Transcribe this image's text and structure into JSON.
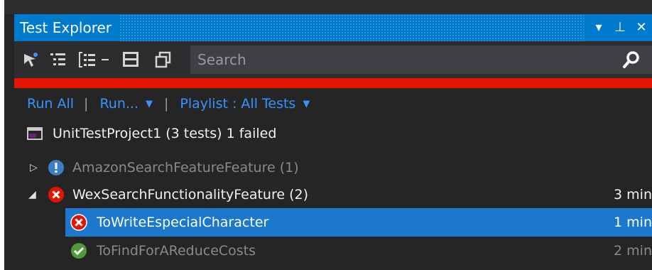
{
  "window": {
    "title": "Test Explorer"
  },
  "title_controls": {
    "dropdown": "▾",
    "pin": "⊥",
    "close": "✕"
  },
  "toolbar": {
    "icons": [
      "run-selected-icon",
      "group-by-icon",
      "filter-traits-icon",
      "dropdown-arrow-icon",
      "playlist-icon",
      "copy-window-icon"
    ],
    "search_placeholder": "Search",
    "search_icon": "magnifier-icon"
  },
  "status": {
    "color": "#e51400"
  },
  "actions": {
    "run_all": "Run All",
    "run": "Run...",
    "playlist": "Playlist : All Tests"
  },
  "tree": {
    "project": {
      "label": "UnitTestProject1 (3 tests) 1 failed"
    },
    "groups": [
      {
        "label": "AmazonSearchFeatureFeature (1)",
        "status": "not-run",
        "expanded": false,
        "duration": ""
      },
      {
        "label": "WexSearchFunctionalityFeature (2)",
        "status": "failed",
        "expanded": true,
        "duration": "3 min"
      }
    ],
    "tests": [
      {
        "label": "ToWriteEspecialCharacter",
        "status": "failed",
        "duration": "1 min",
        "selected": true
      },
      {
        "label": "ToFindForAReduceCosts",
        "status": "passed",
        "duration": "2 min",
        "selected": false
      }
    ]
  },
  "colors": {
    "accent": "#007acc",
    "link": "#3794ff",
    "selected": "#1c78cc",
    "failed": "#e51400",
    "passed": "#4e9a3a",
    "not_run": "#3b7fc4"
  }
}
